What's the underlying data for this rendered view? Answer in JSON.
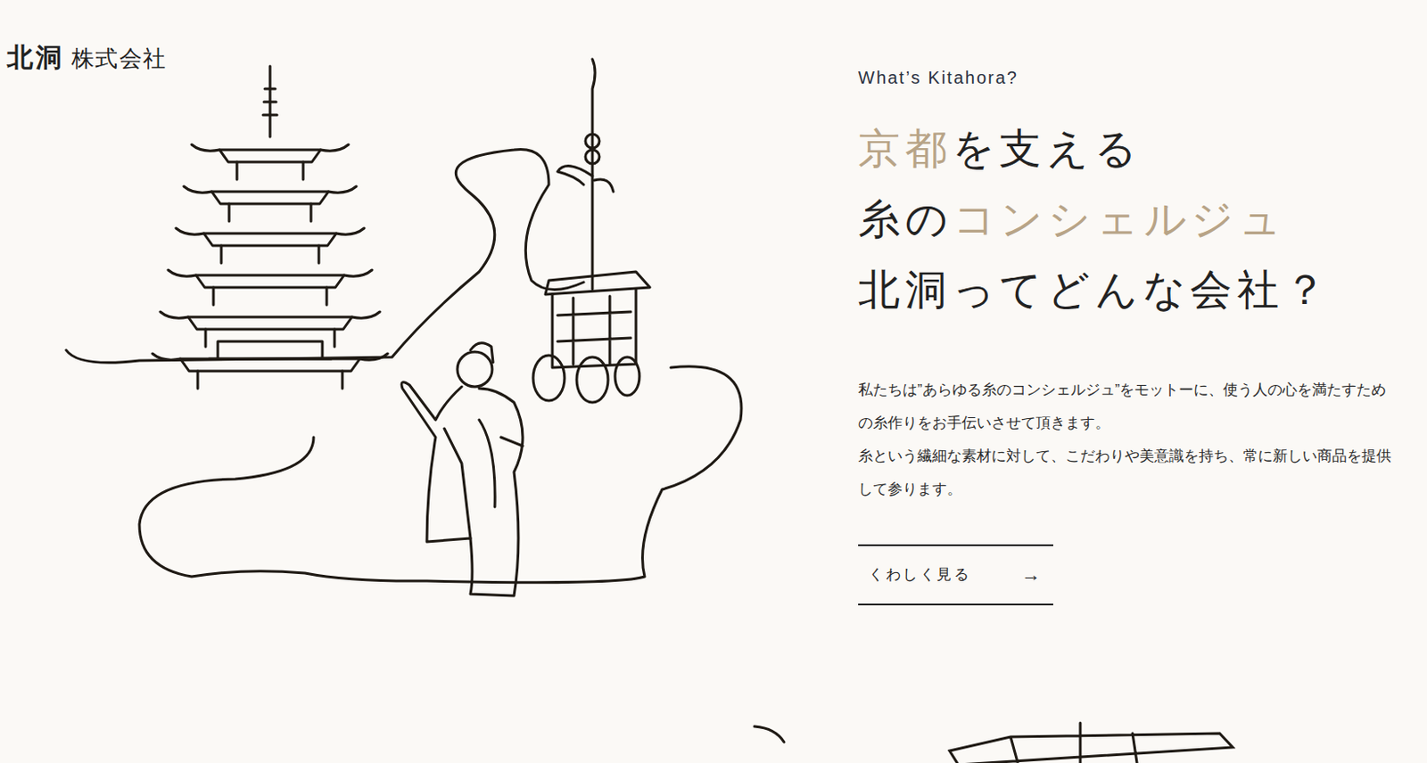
{
  "logo": {
    "name": "北洞",
    "suffix": "株式会社"
  },
  "section": {
    "eyebrow": "What’s Kitahora?",
    "headline": [
      [
        {
          "text": "京都",
          "accent": true
        },
        {
          "text": "を支える",
          "accent": false
        }
      ],
      [
        {
          "text": "糸の",
          "accent": false
        },
        {
          "text": "コンシェルジュ",
          "accent": true
        }
      ],
      [
        {
          "text": "北洞ってどんな会社？",
          "accent": false
        }
      ]
    ],
    "body": [
      "私たちは”あらゆる糸のコンシェルジュ”をモットーに、使う人の心を満たすための糸作りをお手伝いさせて頂きます。",
      "糸という繊細な素材に対して、こだわりや美意識を持ち、常に新しい商品を提供して参ります。"
    ],
    "button": {
      "label": "くわしく見る",
      "icon": "→"
    }
  }
}
